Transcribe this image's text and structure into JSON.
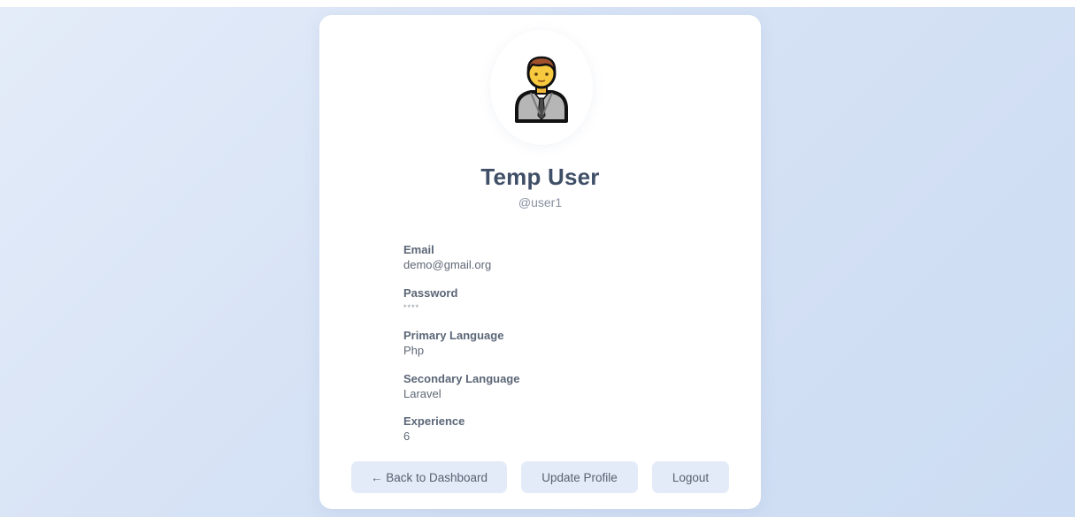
{
  "profile": {
    "avatar_icon": "businessman-person-icon",
    "name": "Temp User",
    "handle": "@user1"
  },
  "fields": [
    {
      "label": "Email",
      "value": "demo@gmail.org"
    },
    {
      "label": "Password",
      "value": "****"
    },
    {
      "label": "Primary Language",
      "value": "Php"
    },
    {
      "label": "Secondary Language",
      "value": "Laravel"
    },
    {
      "label": "Experience",
      "value": "6"
    }
  ],
  "actions": {
    "back_label": "← Back to Dashboard",
    "update_label": "Update Profile",
    "logout_label": "Logout"
  },
  "colors": {
    "background_start": "#e4ecf9",
    "background_end": "#ccdcf2",
    "card": "#ffffff",
    "button_bg": "#e4ebf8",
    "name_text": "#3f4f67"
  }
}
